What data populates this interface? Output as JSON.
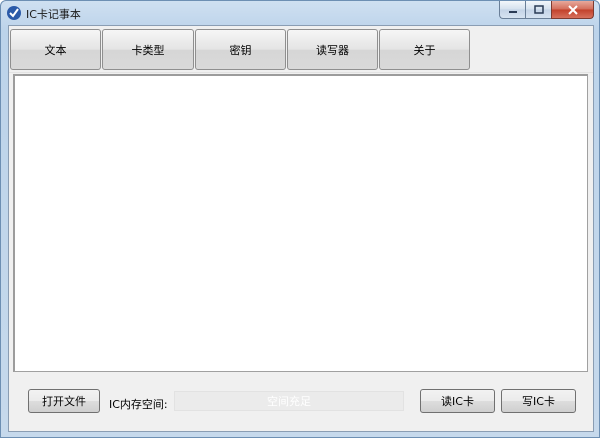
{
  "window": {
    "title": "IC卡记事本",
    "app_icon": "checkmark-shield-icon",
    "controls": {
      "minimize_icon": "minimize-icon",
      "maximize_icon": "maximize-icon",
      "close_icon": "close-icon"
    }
  },
  "tabs": [
    {
      "label": "文本"
    },
    {
      "label": "卡类型"
    },
    {
      "label": "密钥"
    },
    {
      "label": "读写器"
    },
    {
      "label": "关于"
    }
  ],
  "editor": {
    "value": ""
  },
  "footer": {
    "open_file_label": "打开文件",
    "memory_label": "IC内存空间:",
    "memory_status": "空间充足",
    "memory_fraction": 0,
    "read_card_label": "读IC卡",
    "write_card_label": "写IC卡"
  },
  "colors": {
    "title_bar": "#bcd3ea",
    "close_button": "#c2402a",
    "client_bg": "#f0f0f0",
    "progress_fill": "#06b025"
  }
}
